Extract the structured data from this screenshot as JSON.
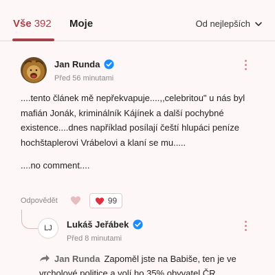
{
  "tabs": {
    "all_label": "Vše",
    "all_count": "392",
    "mine_label": "Moje"
  },
  "sort": {
    "label": "Od nejlepších",
    "icon": "chevron-down-icon"
  },
  "comment": {
    "author": "Jan Runda",
    "time": "Před 56 minutami",
    "paragraphs": [
      "....tento článek mě nepřekvapuje....,,celebritou\" u nás byl mafián Jonák, kriminálník Kájínek a další pochybné existence....dnes například posílají čeští hlupáci peníze hochštaplerovi Vrábelovi a klaní se mu.....",
      "....no comment...."
    ],
    "reply_label": "Odpovědět",
    "like_count": "99",
    "accent": "#a8404a",
    "heart_color": "#e0303f"
  },
  "reply": {
    "avatar_initials": "LJ",
    "author": "Lukáš Jeřábek",
    "time": "Před 8 minutami",
    "reply_to": "Jan Runda",
    "text": "Zapoměl jste na Babiše, ten je ve vrcholové politice a volí ho 35% obyvatel ČR."
  },
  "verified_color": "#1a8cff"
}
